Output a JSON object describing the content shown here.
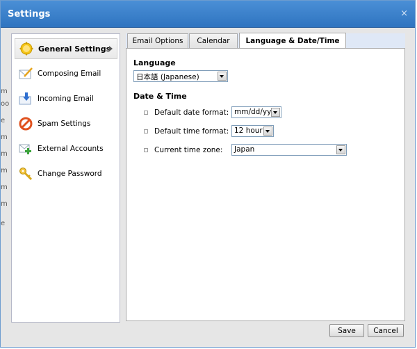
{
  "dialog": {
    "title": "Settings",
    "close_glyph": "×"
  },
  "nav": {
    "items": [
      {
        "label": "General Settings",
        "icon": "gear-icon",
        "active": true
      },
      {
        "label": "Composing Email",
        "icon": "compose-icon",
        "active": false
      },
      {
        "label": "Incoming Email",
        "icon": "incoming-icon",
        "active": false
      },
      {
        "label": "Spam Settings",
        "icon": "spam-icon",
        "active": false
      },
      {
        "label": "External Accounts",
        "icon": "external-accounts-icon",
        "active": false
      },
      {
        "label": "Change Password",
        "icon": "key-icon",
        "active": false
      }
    ]
  },
  "tabs": [
    {
      "label": "Email Options",
      "active": false
    },
    {
      "label": "Calendar",
      "active": false
    },
    {
      "label": "Language & Date/Time",
      "active": true
    }
  ],
  "language": {
    "heading": "Language",
    "value": "日本語 (Japanese)"
  },
  "datetime": {
    "heading": "Date & Time",
    "date_format_label": "Default date format:",
    "date_format_value": "mm/dd/yy",
    "time_format_label": "Default time format:",
    "time_format_value": "12 hour",
    "timezone_label": "Current time zone:",
    "timezone_value": "Japan"
  },
  "footer": {
    "save_label": "Save",
    "cancel_label": "Cancel"
  },
  "background_fragments": [
    "m",
    "oo",
    "e",
    "m",
    "m",
    "m",
    "m",
    "m",
    "e"
  ]
}
